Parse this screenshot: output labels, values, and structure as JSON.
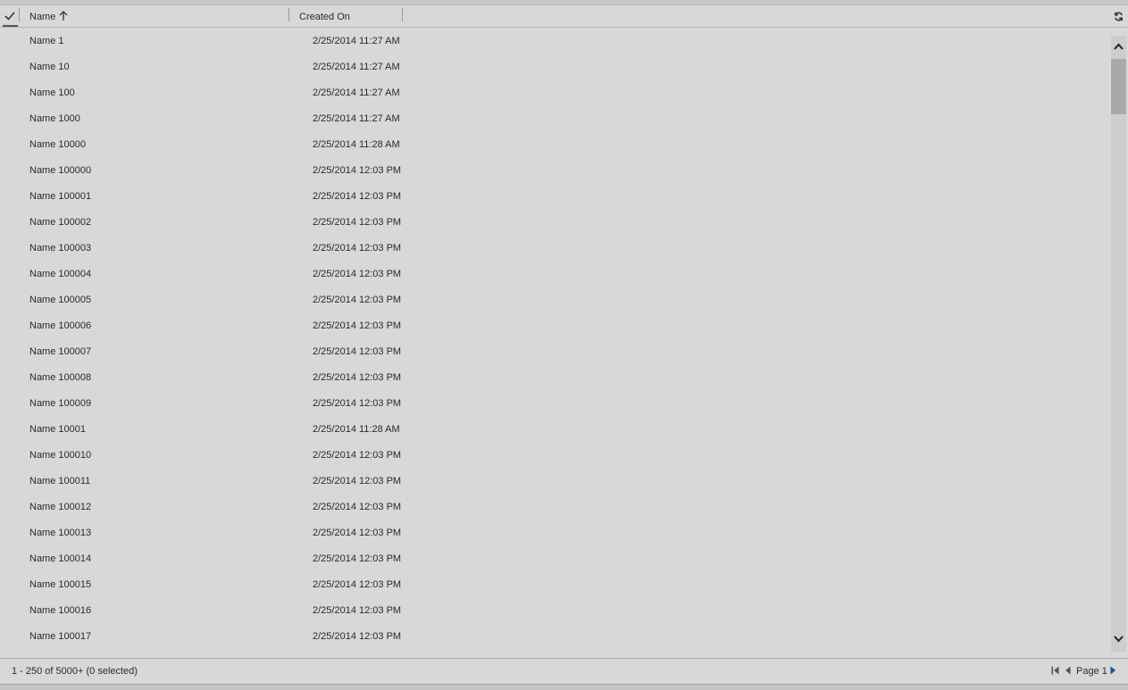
{
  "header": {
    "columns": [
      {
        "label": "Name",
        "sort": "ascending"
      },
      {
        "label": "Created On"
      }
    ]
  },
  "rows": [
    {
      "name": "Name 1",
      "created_on": "2/25/2014 11:27 AM"
    },
    {
      "name": "Name 10",
      "created_on": "2/25/2014 11:27 AM"
    },
    {
      "name": "Name 100",
      "created_on": "2/25/2014 11:27 AM"
    },
    {
      "name": "Name 1000",
      "created_on": "2/25/2014 11:27 AM"
    },
    {
      "name": "Name 10000",
      "created_on": "2/25/2014 11:28 AM"
    },
    {
      "name": "Name 100000",
      "created_on": "2/25/2014 12:03 PM"
    },
    {
      "name": "Name 100001",
      "created_on": "2/25/2014 12:03 PM"
    },
    {
      "name": "Name 100002",
      "created_on": "2/25/2014 12:03 PM"
    },
    {
      "name": "Name 100003",
      "created_on": "2/25/2014 12:03 PM"
    },
    {
      "name": "Name 100004",
      "created_on": "2/25/2014 12:03 PM"
    },
    {
      "name": "Name 100005",
      "created_on": "2/25/2014 12:03 PM"
    },
    {
      "name": "Name 100006",
      "created_on": "2/25/2014 12:03 PM"
    },
    {
      "name": "Name 100007",
      "created_on": "2/25/2014 12:03 PM"
    },
    {
      "name": "Name 100008",
      "created_on": "2/25/2014 12:03 PM"
    },
    {
      "name": "Name 100009",
      "created_on": "2/25/2014 12:03 PM"
    },
    {
      "name": "Name 10001",
      "created_on": "2/25/2014 11:28 AM"
    },
    {
      "name": "Name 100010",
      "created_on": "2/25/2014 12:03 PM"
    },
    {
      "name": "Name 100011",
      "created_on": "2/25/2014 12:03 PM"
    },
    {
      "name": "Name 100012",
      "created_on": "2/25/2014 12:03 PM"
    },
    {
      "name": "Name 100013",
      "created_on": "2/25/2014 12:03 PM"
    },
    {
      "name": "Name 100014",
      "created_on": "2/25/2014 12:03 PM"
    },
    {
      "name": "Name 100015",
      "created_on": "2/25/2014 12:03 PM"
    },
    {
      "name": "Name 100016",
      "created_on": "2/25/2014 12:03 PM"
    },
    {
      "name": "Name 100017",
      "created_on": "2/25/2014 12:03 PM"
    }
  ],
  "footer": {
    "status": "1 - 250 of 5000+ (0 selected)",
    "page_label": "Page 1"
  },
  "icons": {
    "select_all": "checkmark-icon",
    "sort": "arrow-up-icon",
    "refresh": "refresh-icon",
    "scroll_up": "chevron-up-icon",
    "scroll_down": "chevron-down-icon",
    "first_page": "first-page-icon",
    "prev_page": "previous-page-icon",
    "next_page": "next-page-icon"
  },
  "colors": {
    "background": "#d8d8d8",
    "text": "#2a2a2a",
    "next_arrow": "#1f4e8c"
  }
}
